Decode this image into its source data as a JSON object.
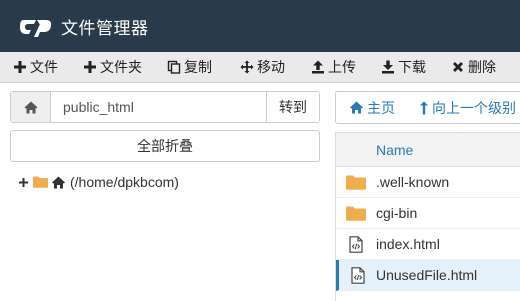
{
  "header": {
    "title": "文件管理器",
    "logo": "cPanel-logo"
  },
  "toolbar": {
    "items": [
      {
        "label": "文件",
        "icon": "plus-icon"
      },
      {
        "label": "文件夹",
        "icon": "plus-icon"
      },
      {
        "label": "复制",
        "icon": "copy-icon"
      },
      {
        "label": "移动",
        "icon": "move-arrows-icon"
      },
      {
        "label": "上传",
        "icon": "upload-icon"
      },
      {
        "label": "下载",
        "icon": "download-icon"
      },
      {
        "label": "删除",
        "icon": "times-icon"
      }
    ]
  },
  "pathbar": {
    "value": "public_html",
    "go_label": "转到",
    "icon": "home-icon"
  },
  "tree": {
    "collapse_label": "全部折叠",
    "root_label": "(/home/dpkbcom)"
  },
  "nav": {
    "home_label": "主页",
    "up_label": "向上一个级别"
  },
  "file_table": {
    "header_name": "Name",
    "rows": [
      {
        "name": ".well-known",
        "type": "folder"
      },
      {
        "name": "cgi-bin",
        "type": "folder"
      },
      {
        "name": "index.html",
        "type": "html-file"
      },
      {
        "name": "UnusedFile.html",
        "type": "html-file",
        "selected": true
      }
    ]
  },
  "colors": {
    "header_bg": "#293a4a",
    "toolbar_bg": "#eaeaea",
    "folder": "#f0ad4e",
    "link": "#2a7ab8"
  }
}
